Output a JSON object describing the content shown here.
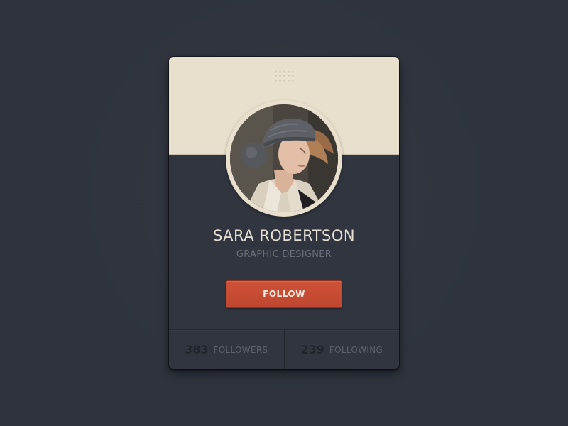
{
  "profile": {
    "name": "SARA ROBERTSON",
    "title": "GRAPHIC DESIGNER",
    "avatar_icon": "profile-photo"
  },
  "actions": {
    "follow_label": "FOLLOW"
  },
  "stats": [
    {
      "count": "383",
      "label": "FOLLOWERS"
    },
    {
      "count": "239",
      "label": "FOLLOWING"
    }
  ],
  "colors": {
    "background": "#2e333d",
    "card_body": "#30353f",
    "card_header": "#e9dfcd",
    "accent": "#c64a32",
    "name_text": "#e6dfd3",
    "muted_text": "#6b707a"
  }
}
